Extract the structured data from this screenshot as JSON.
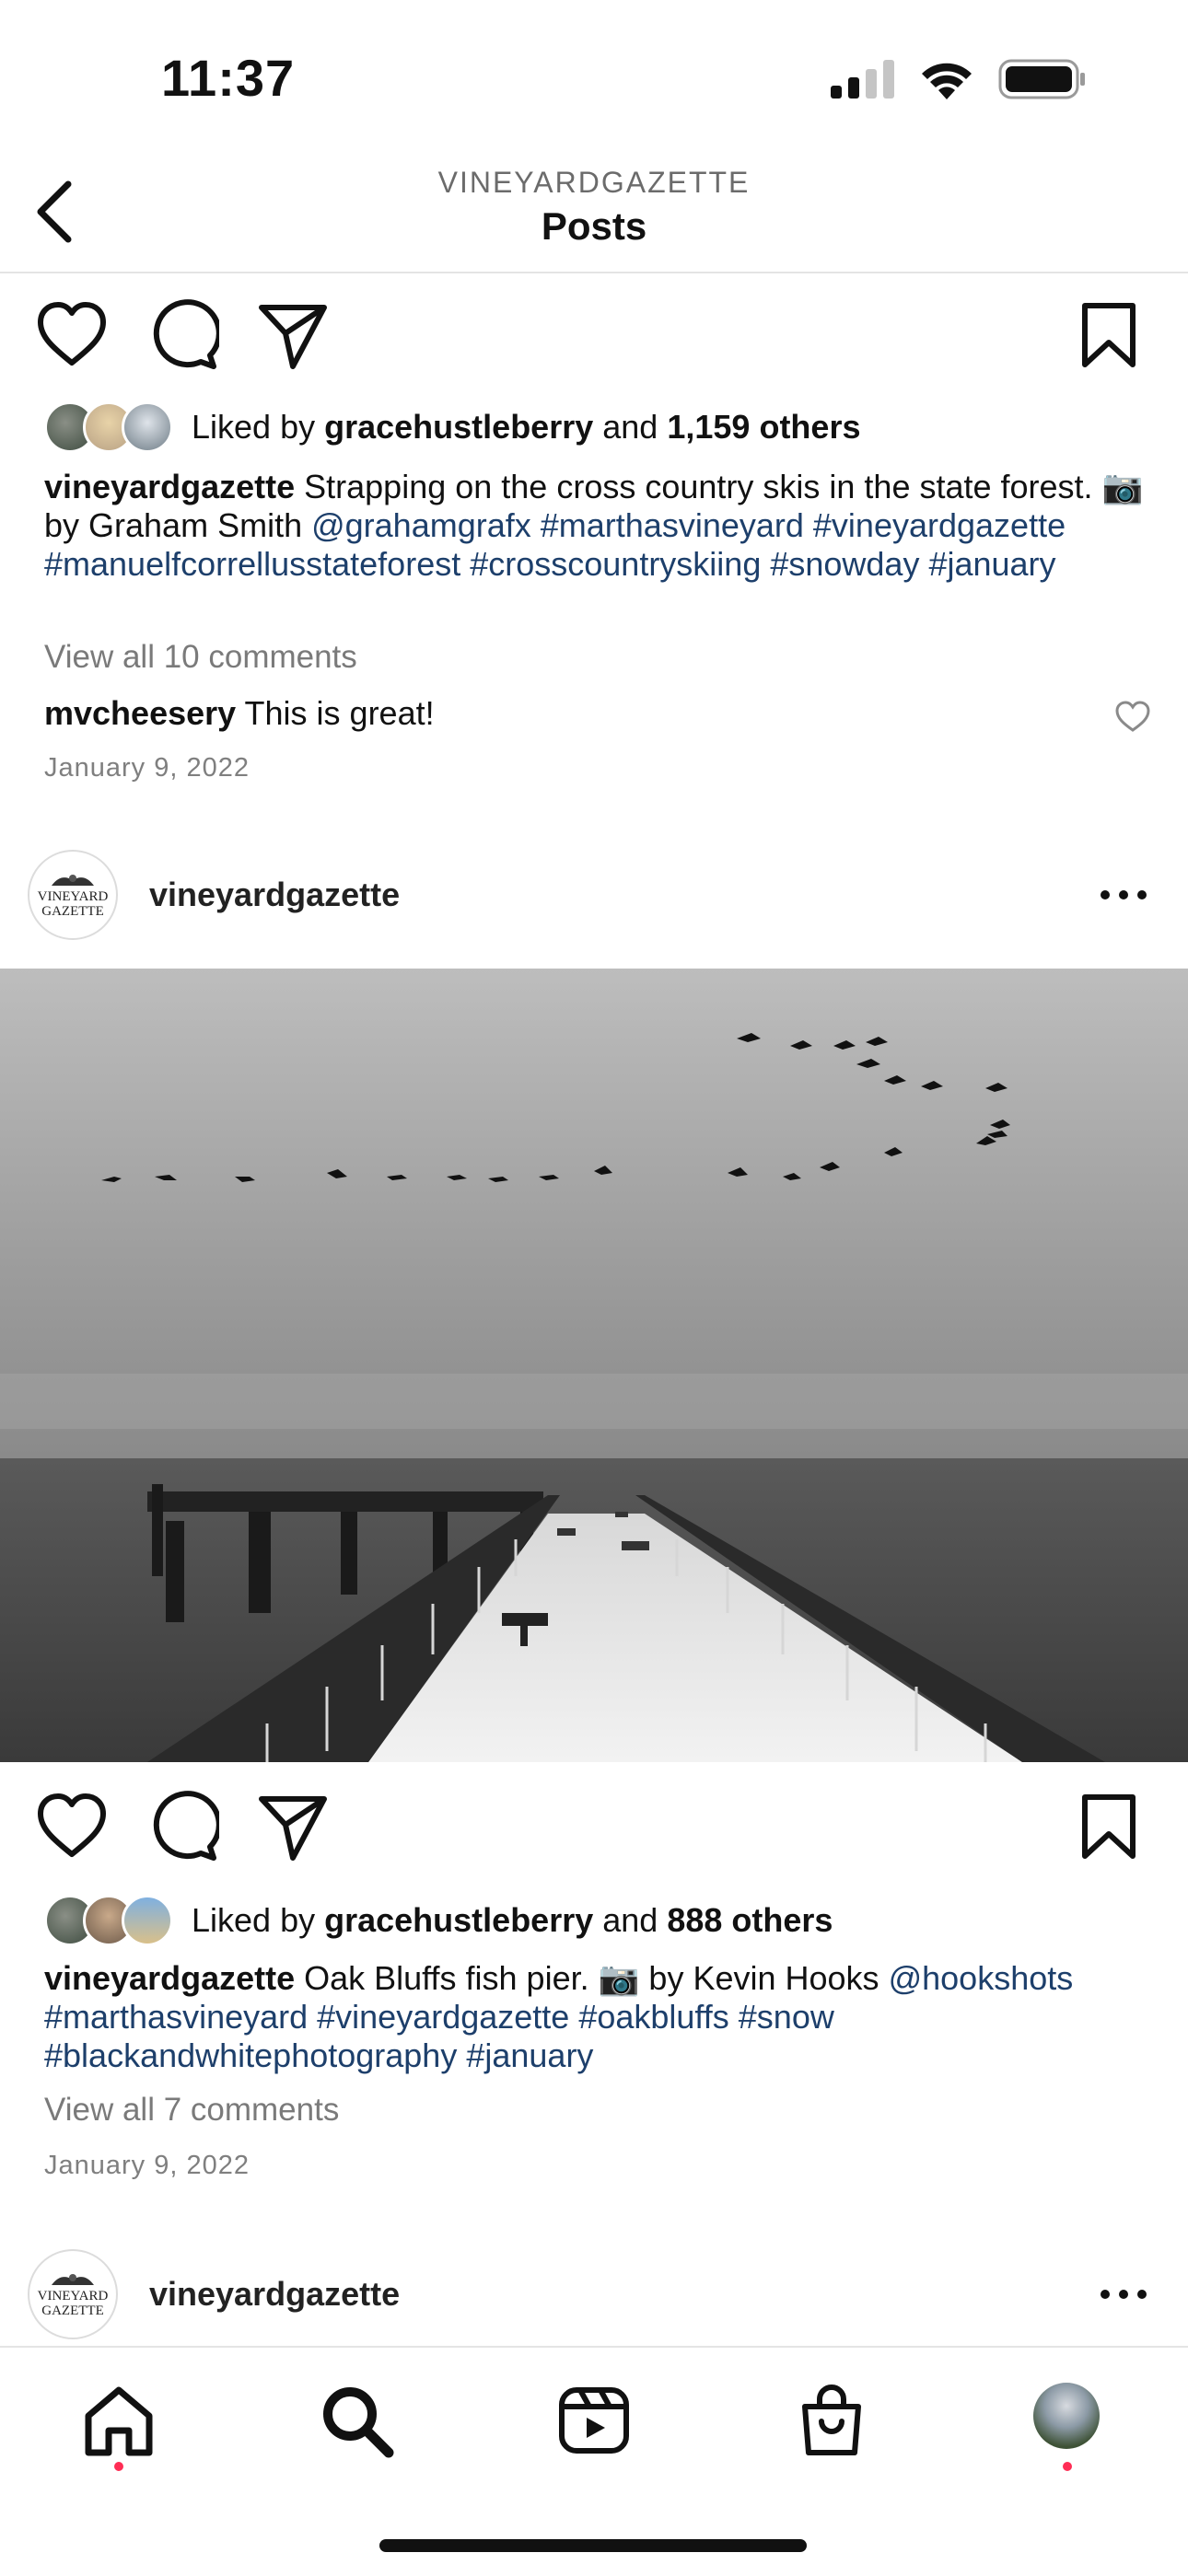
{
  "status": {
    "time": "11:37"
  },
  "header": {
    "account": "VINEYARDGAZETTE",
    "title": "Posts"
  },
  "post1": {
    "likes_prefix": "Liked by",
    "liked_user": "gracehustleberry",
    "likes_and": "and",
    "likes_count": "1,159 others",
    "author": "vineyardgazette",
    "caption_text": "Strapping on the cross country skis in the state forest. 📷 by Graham Smith",
    "mention": "@grahamgrafx",
    "hashtags": "#marthasvineyard #vineyardgazette #manuelfcorrellusstateforest #crosscountryskiing #snowday #january",
    "view_comments": "View all 10 comments",
    "comment_user": "mvcheesery",
    "comment_text": "This is great!",
    "date": "January 9, 2022"
  },
  "post2": {
    "username": "vineyardgazette",
    "logo_line1": "VINEYARD",
    "logo_line2": "GAZETTE",
    "likes_prefix": "Liked by",
    "liked_user": "gracehustleberry",
    "likes_and": "and",
    "likes_count": "888 others",
    "author": "vineyardgazette",
    "caption_text": "Oak Bluffs fish pier. 📷 by Kevin Hooks",
    "mention": "@hookshots",
    "hashtags": "#marthasvineyard #vineyardgazette #oakbluffs #snow #blackandwhitephotography #january",
    "view_comments": "View all 7 comments",
    "date": "January 9, 2022"
  },
  "post3": {
    "username": "vineyardgazette",
    "logo_line1": "VINEYARD",
    "logo_line2": "GAZETTE"
  },
  "icons": {
    "tabbar": [
      "home-icon",
      "search-icon",
      "reels-icon",
      "shop-icon",
      "profile-avatar"
    ],
    "actions": [
      "heart-icon",
      "comment-icon",
      "share-icon",
      "bookmark-icon"
    ]
  },
  "colors": {
    "hashtag": "#1d3f6b",
    "notification_dot": "#ff2d55"
  }
}
